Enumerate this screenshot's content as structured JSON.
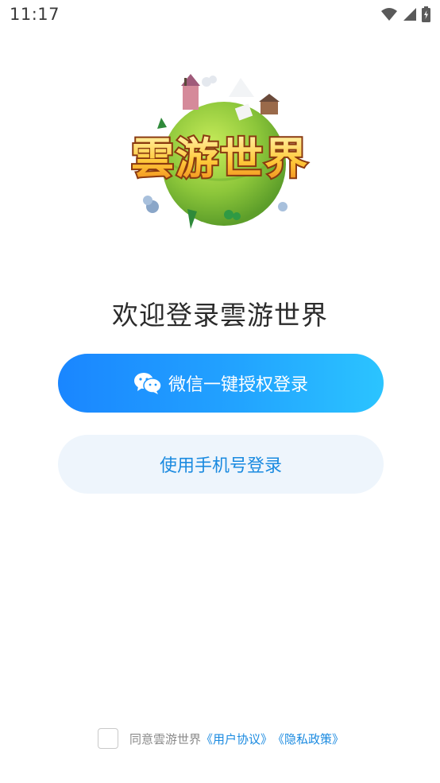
{
  "status_bar": {
    "time": "11:17"
  },
  "logo": {
    "text": "雲游世界"
  },
  "welcome": "欢迎登录雲游世界",
  "buttons": {
    "wechat_login": "微信一键授权登录",
    "phone_login": "使用手机号登录"
  },
  "agreement": {
    "prefix": "同意雲游世界",
    "user_agreement": "《用户协议》",
    "privacy_policy": "《隐私政策》"
  },
  "colors": {
    "primary_gradient_start": "#1a86ff",
    "primary_gradient_end": "#2bc4ff",
    "secondary_bg": "#eef5fc",
    "link": "#1a8ae0"
  },
  "icons": [
    "wifi-icon",
    "cell-signal-icon",
    "battery-charging-icon",
    "wechat-icon"
  ]
}
